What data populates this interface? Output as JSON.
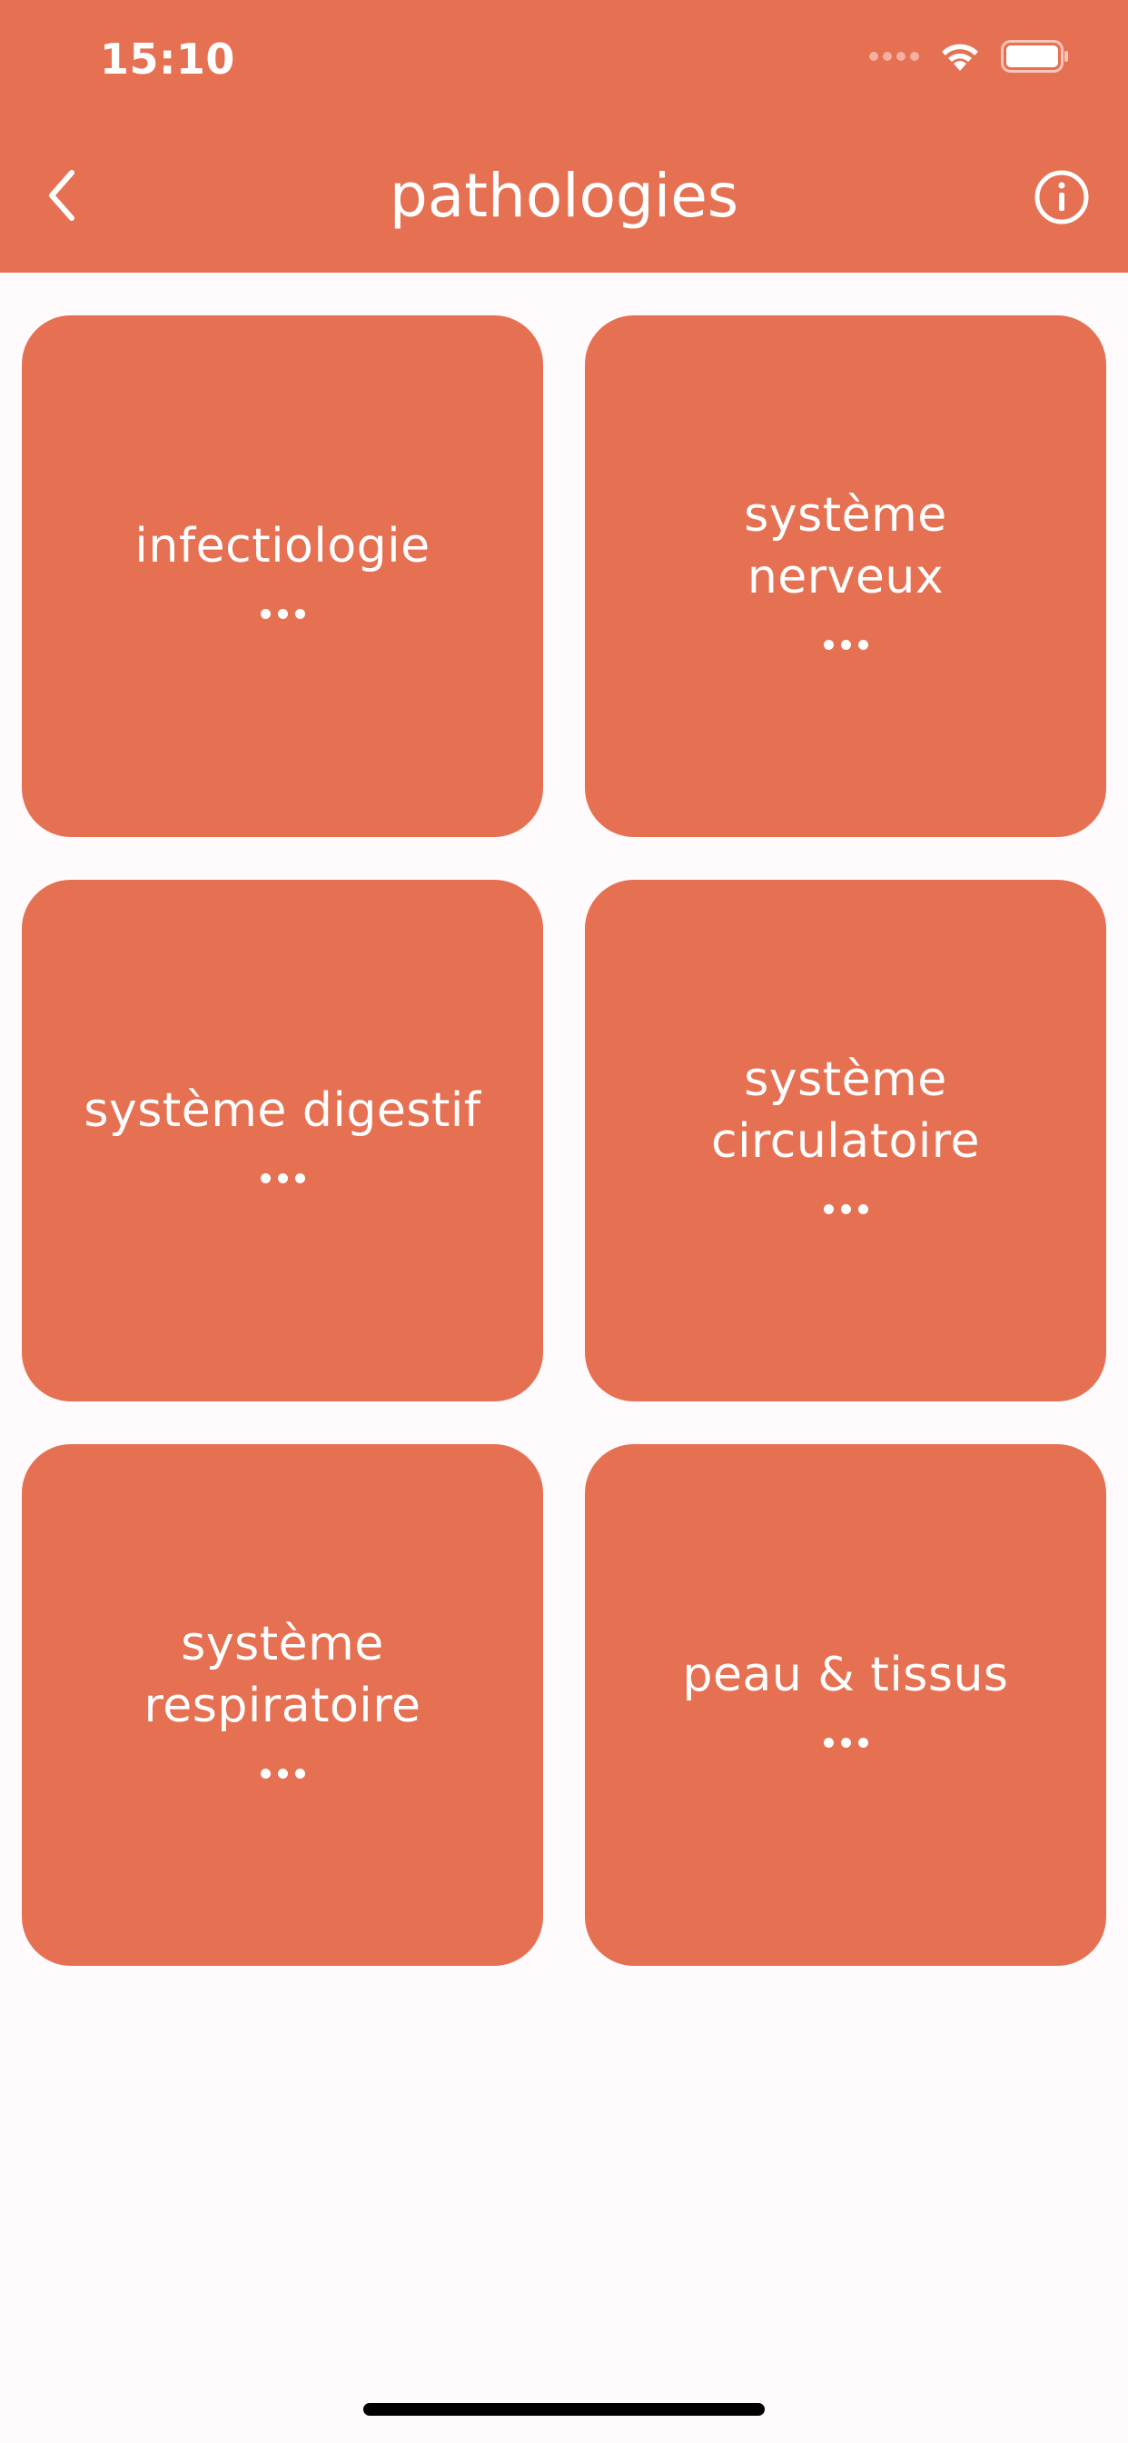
{
  "status_bar": {
    "time": "15:10",
    "icons": [
      "cellular-signal-icon",
      "wifi-icon",
      "battery-icon"
    ]
  },
  "header": {
    "title": "pathologies",
    "back_icon": "chevron-left-icon",
    "info_icon": "info-circle-icon"
  },
  "categories": [
    {
      "label": "infectiologie",
      "more_icon": "ellipsis-icon"
    },
    {
      "label": "système nerveux",
      "more_icon": "ellipsis-icon"
    },
    {
      "label": "système digestif",
      "more_icon": "ellipsis-icon"
    },
    {
      "label": "système circulatoire",
      "more_icon": "ellipsis-icon"
    },
    {
      "label": "système respiratoire",
      "more_icon": "ellipsis-icon"
    },
    {
      "label": "peau & tissus",
      "more_icon": "ellipsis-icon"
    }
  ],
  "colors": {
    "accent": "#e67052",
    "background": "#fffbfd",
    "text_on_accent": "#ffffff"
  }
}
